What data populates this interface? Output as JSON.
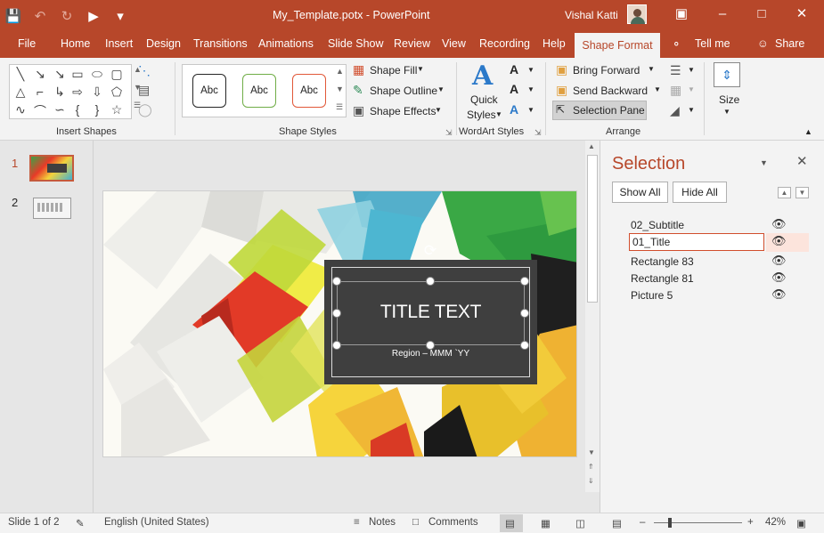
{
  "window": {
    "doc_title": "My_Template.potx  -  PowerPoint",
    "user_name": "Vishal Katti",
    "qat": [
      "save-icon",
      "undo-icon",
      "redo-icon",
      "present-icon",
      "customize-icon"
    ]
  },
  "tabs": [
    "File",
    "Home",
    "Insert",
    "Design",
    "Transitions",
    "Animations",
    "Slide Show",
    "Review",
    "View",
    "Recording",
    "Help",
    "Shape Format",
    "Tell me",
    "Share"
  ],
  "ribbon": {
    "insert_shapes_label": "Insert Shapes",
    "shape_styles_label": "Shape Styles",
    "style_samples": [
      "Abc",
      "Abc",
      "Abc"
    ],
    "style_colors": [
      "#262626",
      "#70ad47",
      "#e15839"
    ],
    "shape_fill": "Shape Fill",
    "shape_outline": "Shape Outline",
    "shape_effects": "Shape Effects",
    "quick_styles_1": "Quick",
    "quick_styles_2": "Styles",
    "wordart_label": "WordArt Styles",
    "bring_forward": "Bring Forward",
    "send_backward": "Send Backward",
    "selection_pane": "Selection Pane",
    "arrange_label": "Arrange",
    "size_label": "Size"
  },
  "thumbnails": [
    "1",
    "2"
  ],
  "slide": {
    "title": "TITLE TEXT",
    "subtitle": "Region  –  MMM `YY"
  },
  "selection_pane": {
    "title": "Selection",
    "show_all": "Show All",
    "hide_all": "Hide All",
    "items": [
      "02_Subtitle",
      "01_Title",
      "Rectangle 83",
      "Rectangle 81",
      "Picture 5"
    ],
    "editing_value": "01_Title"
  },
  "status": {
    "slide_info": "Slide 1 of 2",
    "language": "English (United States)",
    "notes": "Notes",
    "comments": "Comments",
    "zoom": "42%"
  },
  "colors": {
    "accent": "#b7472a"
  }
}
